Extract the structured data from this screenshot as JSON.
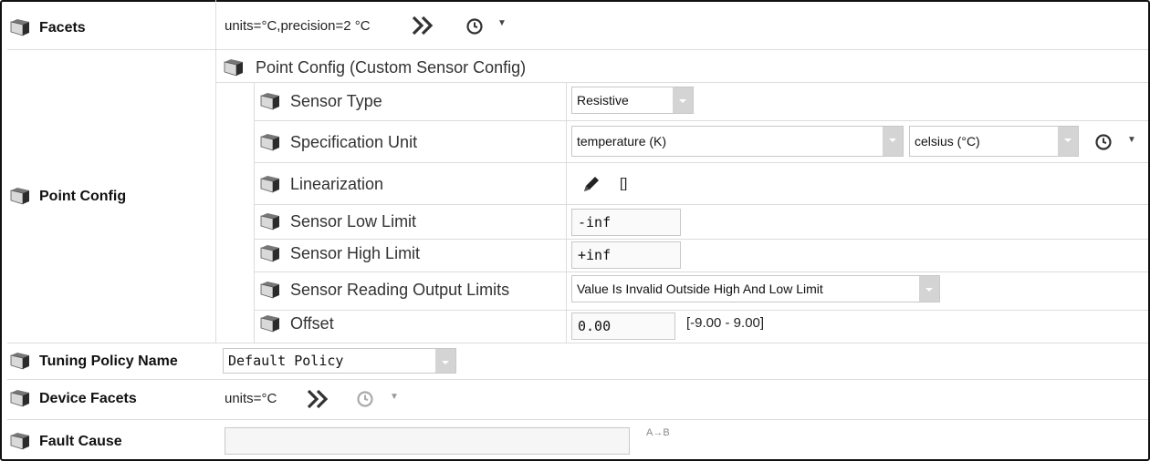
{
  "facets": {
    "label": "Facets",
    "value": "units=°C,precision=2 °C"
  },
  "point_config": {
    "label": "Point Config",
    "header": "Point Config  (Custom Sensor Config)",
    "rows": {
      "sensor_type": {
        "label": "Sensor Type",
        "value": "Resistive"
      },
      "specification_unit": {
        "label": "Specification Unit",
        "quantity": "temperature (K)",
        "unit": "celsius (°C)"
      },
      "linearization": {
        "label": "Linearization",
        "value": "[]"
      },
      "sensor_low_limit": {
        "label": "Sensor Low Limit",
        "value": "-inf"
      },
      "sensor_high_limit": {
        "label": "Sensor High Limit",
        "value": "+inf"
      },
      "output_limits": {
        "label": "Sensor Reading Output Limits",
        "value": "Value Is Invalid Outside High And Low Limit"
      },
      "offset": {
        "label": "Offset",
        "value": "0.00",
        "range": "[-9.00 - 9.00]"
      }
    }
  },
  "tuning_policy": {
    "label": "Tuning Policy Name",
    "value": "Default Policy"
  },
  "device_facets": {
    "label": "Device Facets",
    "value": "units=°C"
  },
  "fault_cause": {
    "label": "Fault Cause",
    "value": "",
    "icon_text": "A→B"
  },
  "icons": {
    "component": "cube-icon",
    "expand": "double-chevron-icon",
    "clock": "clock-icon",
    "edit": "pencil-icon"
  }
}
